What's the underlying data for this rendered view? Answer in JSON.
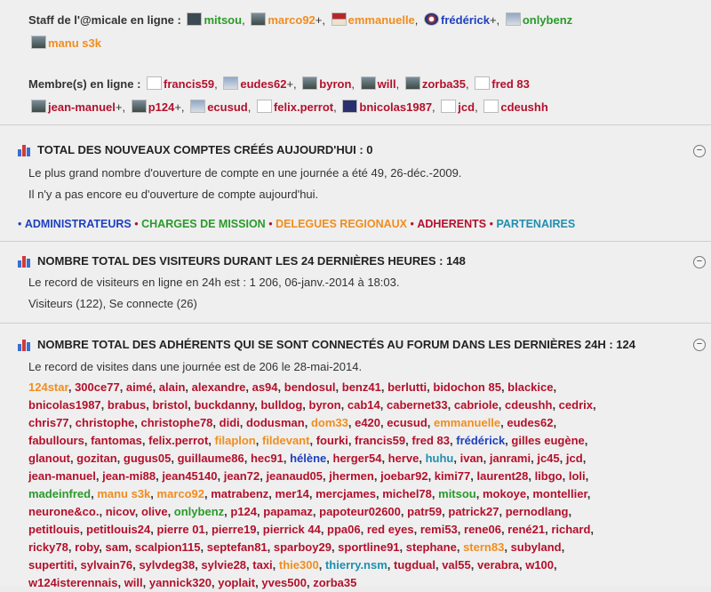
{
  "online": {
    "staff_label": "Staff de l'@micale en ligne :",
    "staff": [
      {
        "name": "mitsou",
        "color": "#2a9a2a",
        "suffix": ",",
        "avatar": "av-dark"
      },
      {
        "name": "marco92",
        "color": "#f08d1f",
        "suffix": "+,",
        "avatar": "av-photo"
      },
      {
        "name": "emmanuelle",
        "color": "#f08d1f",
        "suffix": ",",
        "avatar": "av-flag"
      },
      {
        "name": "frédérick",
        "color": "#1e3fbf",
        "suffix": "+,",
        "avatar": "av-badge"
      },
      {
        "name": "onlybenz",
        "color": "#2a9a2a",
        "suffix": "",
        "avatar": "av-car"
      },
      {
        "name": "manu s3k",
        "color": "#f08d1f",
        "suffix": "",
        "avatar": "av-photo"
      }
    ],
    "members_label": "Membre(s) en ligne :",
    "members": [
      {
        "name": "francis59",
        "suffix": ",",
        "avatar": "av-blank"
      },
      {
        "name": "eudes62",
        "suffix": "+,",
        "avatar": "av-car"
      },
      {
        "name": "byron",
        "suffix": ",",
        "avatar": "av-photo"
      },
      {
        "name": "will",
        "suffix": ",",
        "avatar": "av-photo"
      },
      {
        "name": "zorba35",
        "suffix": ",",
        "avatar": "av-photo"
      },
      {
        "name": "fred 83",
        "suffix": "",
        "avatar": "av-blank"
      },
      {
        "name": "jean-manuel",
        "suffix": "+,",
        "avatar": "av-photo"
      },
      {
        "name": "p124",
        "suffix": "+,",
        "avatar": "av-photo"
      },
      {
        "name": "ecusud",
        "suffix": ",",
        "avatar": "av-car"
      },
      {
        "name": "felix.perrot",
        "suffix": ",",
        "avatar": "av-blank"
      },
      {
        "name": "bnicolas1987",
        "suffix": ",",
        "avatar": "av-black"
      },
      {
        "name": "jcd",
        "suffix": ",",
        "avatar": "av-blank"
      },
      {
        "name": "cdeushh",
        "suffix": "",
        "avatar": "av-blank"
      }
    ]
  },
  "new_accounts": {
    "title": "TOTAL DES NOUVEAUX COMPTES CRÉÉS AUJOURD'HUI : 0",
    "line1": "Le plus grand nombre d'ouverture de compte en une journée a été 49, 26-déc.-2009.",
    "line2": "Il n'y a pas encore eu d'ouverture de compte aujourd'hui.",
    "collapse": "−"
  },
  "roles": [
    {
      "label": "ADMINISTRATEURS",
      "color": "#1e3fbf"
    },
    {
      "label": "CHARGES DE MISSION",
      "color": "#2a9a2a"
    },
    {
      "label": "DELEGUES REGIONAUX",
      "color": "#f08d1f"
    },
    {
      "label": "ADHERENTS",
      "color": "#b3102b"
    },
    {
      "label": "PARTENAIRES",
      "color": "#1f8fb0"
    }
  ],
  "visitors": {
    "title": "NOMBRE TOTAL DES VISITEURS DURANT LES 24 DERNIÈRES HEURES : 148",
    "line1": "Le record de visiteurs en ligne en 24h est : 1 206, 06-janv.-2014 à 18:03.",
    "line2": "Visiteurs (122), Se connecte (26)",
    "collapse": "−"
  },
  "connected": {
    "title": "NOMBRE TOTAL DES ADHÉRENTS QUI SE SONT CONNECTÉS AU FORUM DANS LES DERNIÈRES 24H : 124",
    "line1": "Le record de visites dans une journée est de 206 le 28-mai-2014.",
    "collapse": "−",
    "rows": [
      [
        [
          "124star",
          "#f08d1f"
        ],
        [
          "300ce77",
          "#b3102b"
        ],
        [
          "aimé",
          "#b3102b"
        ],
        [
          "alain",
          "#b3102b"
        ],
        [
          "alexandre",
          "#b3102b"
        ],
        [
          "as94",
          "#b3102b"
        ],
        [
          "bendosul",
          "#b3102b"
        ],
        [
          "benz41",
          "#b3102b"
        ],
        [
          "berlutti",
          "#b3102b"
        ],
        [
          "bidochon 85",
          "#b3102b"
        ],
        [
          "blackice",
          "#b3102b"
        ]
      ],
      [
        [
          "bnicolas1987",
          "#b3102b"
        ],
        [
          "brabus",
          "#b3102b"
        ],
        [
          "bristol",
          "#b3102b"
        ],
        [
          "buckdanny",
          "#b3102b"
        ],
        [
          "bulldog",
          "#b3102b"
        ],
        [
          "byron",
          "#b3102b"
        ],
        [
          "cab14",
          "#b3102b"
        ],
        [
          "cabernet33",
          "#b3102b"
        ],
        [
          "cabriole",
          "#b3102b"
        ],
        [
          "cdeushh",
          "#b3102b"
        ],
        [
          "cedrix",
          "#b3102b"
        ]
      ],
      [
        [
          "chris77",
          "#b3102b"
        ],
        [
          "christophe",
          "#b3102b"
        ],
        [
          "christophe78",
          "#b3102b"
        ],
        [
          "didi",
          "#b3102b"
        ],
        [
          "dodusman",
          "#b3102b"
        ],
        [
          "dom33",
          "#f08d1f"
        ],
        [
          "e420",
          "#b3102b"
        ],
        [
          "ecusud",
          "#b3102b"
        ],
        [
          "emmanuelle",
          "#f08d1f"
        ],
        [
          "eudes62",
          "#b3102b"
        ]
      ],
      [
        [
          "fabullours",
          "#b3102b"
        ],
        [
          "fantomas",
          "#b3102b"
        ],
        [
          "felix.perrot",
          "#b3102b"
        ],
        [
          "filaplon",
          "#f08d1f"
        ],
        [
          "fildevant",
          "#f08d1f"
        ],
        [
          "fourki",
          "#b3102b"
        ],
        [
          "francis59",
          "#b3102b"
        ],
        [
          "fred 83",
          "#b3102b"
        ],
        [
          "frédérick",
          "#1e3fbf"
        ],
        [
          "gilles eugène",
          "#b3102b"
        ]
      ],
      [
        [
          "glanout",
          "#b3102b"
        ],
        [
          "gozitan",
          "#b3102b"
        ],
        [
          "gugus05",
          "#b3102b"
        ],
        [
          "guillaume86",
          "#b3102b"
        ],
        [
          "hec91",
          "#b3102b"
        ],
        [
          "hélène",
          "#1e3fbf"
        ],
        [
          "herger54",
          "#b3102b"
        ],
        [
          "herve",
          "#b3102b"
        ],
        [
          "huhu",
          "#1f8fb0"
        ],
        [
          "ivan",
          "#b3102b"
        ],
        [
          "janrami",
          "#b3102b"
        ],
        [
          "jc45",
          "#b3102b"
        ],
        [
          "jcd",
          "#b3102b"
        ]
      ],
      [
        [
          "jean-manuel",
          "#b3102b"
        ],
        [
          "jean-mi88",
          "#b3102b"
        ],
        [
          "jean45140",
          "#b3102b"
        ],
        [
          "jean72",
          "#b3102b"
        ],
        [
          "jeanaud05",
          "#b3102b"
        ],
        [
          "jhermen",
          "#b3102b"
        ],
        [
          "joebar92",
          "#b3102b"
        ],
        [
          "kimi77",
          "#b3102b"
        ],
        [
          "laurent28",
          "#b3102b"
        ],
        [
          "libgo",
          "#b3102b"
        ],
        [
          "loli",
          "#b3102b"
        ]
      ],
      [
        [
          "madeinfred",
          "#2a9a2a"
        ],
        [
          "manu s3k",
          "#f08d1f"
        ],
        [
          "marco92",
          "#f08d1f"
        ],
        [
          "matrabenz",
          "#b3102b"
        ],
        [
          "mer14",
          "#b3102b"
        ],
        [
          "mercjames",
          "#b3102b"
        ],
        [
          "michel78",
          "#b3102b"
        ],
        [
          "mitsou",
          "#2a9a2a"
        ],
        [
          "mokoye",
          "#b3102b"
        ],
        [
          "montellier",
          "#b3102b"
        ]
      ],
      [
        [
          "neurone&co.",
          "#b3102b"
        ],
        [
          "nicov",
          "#b3102b"
        ],
        [
          "olive",
          "#b3102b"
        ],
        [
          "onlybenz",
          "#2a9a2a"
        ],
        [
          "p124",
          "#b3102b"
        ],
        [
          "papamaz",
          "#b3102b"
        ],
        [
          "papoteur02600",
          "#b3102b"
        ],
        [
          "patr59",
          "#b3102b"
        ],
        [
          "patrick27",
          "#b3102b"
        ],
        [
          "pernodlang",
          "#b3102b"
        ]
      ],
      [
        [
          "petitlouis",
          "#b3102b"
        ],
        [
          "petitlouis24",
          "#b3102b"
        ],
        [
          "pierre 01",
          "#b3102b"
        ],
        [
          "pierre19",
          "#b3102b"
        ],
        [
          "pierrick 44",
          "#b3102b"
        ],
        [
          "ppa06",
          "#b3102b"
        ],
        [
          "red eyes",
          "#b3102b"
        ],
        [
          "remi53",
          "#b3102b"
        ],
        [
          "rene06",
          "#b3102b"
        ],
        [
          "rené21",
          "#b3102b"
        ],
        [
          "richard",
          "#b3102b"
        ]
      ],
      [
        [
          "ricky78",
          "#b3102b"
        ],
        [
          "roby",
          "#b3102b"
        ],
        [
          "sam",
          "#b3102b"
        ],
        [
          "scalpion115",
          "#b3102b"
        ],
        [
          "septefan81",
          "#b3102b"
        ],
        [
          "sparboy29",
          "#b3102b"
        ],
        [
          "sportline91",
          "#b3102b"
        ],
        [
          "stephane",
          "#b3102b"
        ],
        [
          "stern83",
          "#f08d1f"
        ],
        [
          "subyland",
          "#b3102b"
        ]
      ],
      [
        [
          "supertiti",
          "#b3102b"
        ],
        [
          "sylvain76",
          "#b3102b"
        ],
        [
          "sylvdeg38",
          "#b3102b"
        ],
        [
          "sylvie28",
          "#b3102b"
        ],
        [
          "taxi",
          "#b3102b"
        ],
        [
          "thie300",
          "#f08d1f"
        ],
        [
          "thierry.nsm",
          "#1f8fb0"
        ],
        [
          "tugdual",
          "#b3102b"
        ],
        [
          "val55",
          "#b3102b"
        ],
        [
          "verabra",
          "#b3102b"
        ],
        [
          "w100",
          "#b3102b"
        ]
      ],
      [
        [
          "w124isterennais",
          "#b3102b"
        ],
        [
          "will",
          "#b3102b"
        ],
        [
          "yannick320",
          "#b3102b"
        ],
        [
          "yoplait",
          "#b3102b"
        ],
        [
          "yves500",
          "#b3102b"
        ],
        [
          "zorba35",
          "#b3102b"
        ]
      ]
    ]
  }
}
